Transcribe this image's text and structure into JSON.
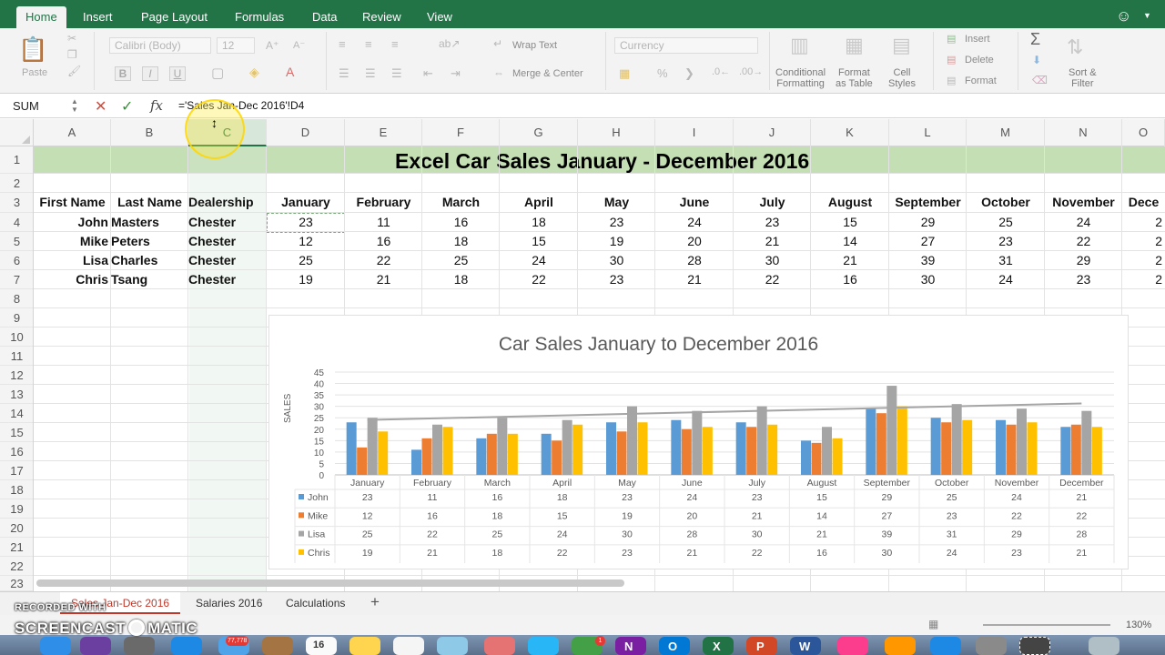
{
  "ribbon_tabs": [
    "Home",
    "Insert",
    "Page Layout",
    "Formulas",
    "Data",
    "Review",
    "View"
  ],
  "ribbon_active_tab": "Home",
  "ribbon": {
    "paste_label": "Paste",
    "font_name": "Calibri (Body)",
    "font_size": "12",
    "bold": "B",
    "italic": "I",
    "underline": "U",
    "wrap_text": "Wrap Text",
    "merge_center": "Merge & Center",
    "number_format": "Currency",
    "percent": "%",
    "conditional_formatting": "Conditional\nFormatting",
    "format_as_table": "Format\nas Table",
    "cell_styles": "Cell\nStyles",
    "insert": "Insert",
    "delete": "Delete",
    "format": "Format",
    "sort_filter": "Sort &\nFilter",
    "sigma": "Σ"
  },
  "formula_bar": {
    "name_box": "SUM",
    "fx": "fx",
    "formula": "='Sales Jan-Dec 2016'!D4"
  },
  "columns": [
    "A",
    "B",
    "C",
    "D",
    "E",
    "F",
    "G",
    "H",
    "I",
    "J",
    "K",
    "L",
    "M",
    "N",
    "O"
  ],
  "selected_column": "C",
  "rows": [
    "1",
    "2",
    "3",
    "4",
    "5",
    "6",
    "7",
    "8",
    "9",
    "10",
    "11",
    "12",
    "13",
    "14",
    "15",
    "16",
    "17",
    "18",
    "19",
    "20",
    "21",
    "22",
    "23"
  ],
  "sheet_title": "Excel Car Sales January - December 2016",
  "table_headers": [
    "First Name",
    "Last Name",
    "Dealership",
    "January",
    "February",
    "March",
    "April",
    "May",
    "June",
    "July",
    "August",
    "September",
    "October",
    "November",
    "Dece"
  ],
  "people": [
    {
      "first": "John",
      "last": "Masters",
      "dealer": "Chester",
      "sales": [
        "23",
        "11",
        "16",
        "18",
        "23",
        "24",
        "23",
        "15",
        "29",
        "25",
        "24",
        "2"
      ]
    },
    {
      "first": "Mike",
      "last": "Peters",
      "dealer": "Chester",
      "sales": [
        "12",
        "16",
        "18",
        "15",
        "19",
        "20",
        "21",
        "14",
        "27",
        "23",
        "22",
        "2"
      ]
    },
    {
      "first": "Lisa",
      "last": "Charles",
      "dealer": "Chester",
      "sales": [
        "25",
        "22",
        "25",
        "24",
        "30",
        "28",
        "30",
        "21",
        "39",
        "31",
        "29",
        "2"
      ]
    },
    {
      "first": "Chris",
      "last": "Tsang",
      "dealer": "Chester",
      "sales": [
        "19",
        "21",
        "18",
        "22",
        "23",
        "21",
        "22",
        "16",
        "30",
        "24",
        "23",
        "2"
      ]
    }
  ],
  "chart_data": {
    "type": "bar",
    "title": "Car Sales January to December 2016",
    "xlabel": "",
    "ylabel": "SALES",
    "ylim": [
      0,
      45
    ],
    "yticks": [
      "0",
      "5",
      "10",
      "15",
      "20",
      "25",
      "30",
      "35",
      "40",
      "45"
    ],
    "grid": true,
    "legend": "data-table",
    "categories": [
      "January",
      "February",
      "March",
      "April",
      "May",
      "June",
      "July",
      "August",
      "September",
      "October",
      "November",
      "December"
    ],
    "series": [
      {
        "name": "John",
        "color": "#5b9bd5",
        "values": [
          23,
          11,
          16,
          18,
          23,
          24,
          23,
          15,
          29,
          25,
          24,
          21
        ]
      },
      {
        "name": "Mike",
        "color": "#ed7d31",
        "values": [
          12,
          16,
          18,
          15,
          19,
          20,
          21,
          14,
          27,
          23,
          22,
          22
        ]
      },
      {
        "name": "Lisa",
        "color": "#a5a5a5",
        "values": [
          25,
          22,
          25,
          24,
          30,
          28,
          30,
          21,
          39,
          31,
          29,
          28
        ]
      },
      {
        "name": "Chris",
        "color": "#ffc000",
        "values": [
          19,
          21,
          18,
          22,
          23,
          21,
          22,
          16,
          30,
          24,
          23,
          21
        ]
      }
    ],
    "trendline": {
      "series": "Lisa",
      "color": "#a5a5a5"
    }
  },
  "sheet_tabs": [
    "Sales Jan-Dec 2016",
    "Salaries 2016",
    "Calculations"
  ],
  "active_sheet": "Sales Jan-Dec 2016",
  "add_sheet": "+",
  "zoom": "130%",
  "watermark": {
    "line1": "RECORDED WITH",
    "line2a": "SCREENCAST",
    "line2b": "MATIC"
  },
  "dock": {
    "badge_mail": "77,778",
    "badge_msg": "1",
    "calendar_day": "16"
  },
  "colors": {
    "excel_green": "#227447",
    "title_band": "#c5dfb4",
    "active_tab_red": "#c0392b"
  }
}
